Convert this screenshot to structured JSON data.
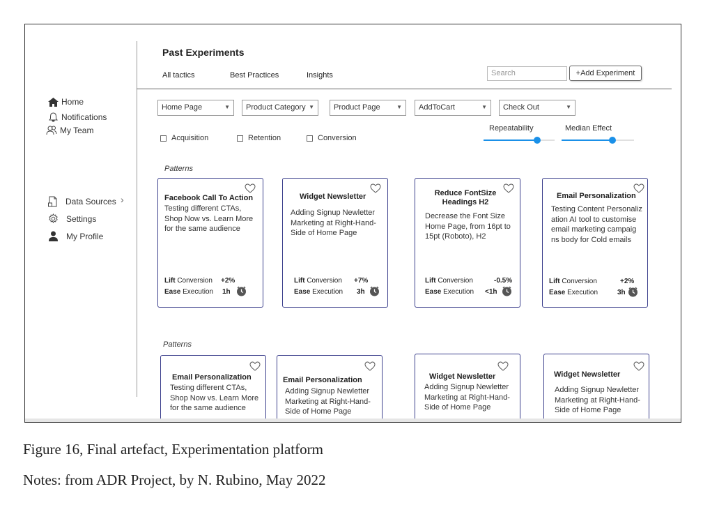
{
  "sidebar": {
    "top_items": [
      {
        "label": "Home",
        "icon": "home-icon"
      },
      {
        "label": "Notifications",
        "icon": "bell-icon"
      },
      {
        "label": "My Team",
        "icon": "team-icon"
      }
    ],
    "bottom_items": [
      {
        "label": "Data Sources",
        "icon": "data-sources-icon"
      },
      {
        "label": "Settings",
        "icon": "gear-icon"
      },
      {
        "label": "My Profile",
        "icon": "user-icon"
      }
    ]
  },
  "header": {
    "title": "Past Experiments",
    "tabs": [
      "All tactics",
      "Best Practices",
      "Insights"
    ],
    "search_placeholder": "Search",
    "add_button": "+Add Experiment"
  },
  "filters": {
    "dropdowns": [
      "Home Page",
      "Product Category",
      "Product Page",
      "AddToCart",
      "Check Out"
    ],
    "checkboxes": [
      "Acquisition",
      "Retention",
      "Conversion"
    ],
    "sliders": [
      {
        "label": "Repeatability",
        "value": 0.75
      },
      {
        "label": "Median Effect",
        "value": 0.7
      }
    ]
  },
  "sections": [
    {
      "label": "Patterns",
      "cards": [
        {
          "title": "Facebook Call To Action",
          "desc": "Testing different CTAs, Shop Now vs. Learn More for the same audience",
          "lift_label": "Lift",
          "lift_metric": "Conversion",
          "lift_value": "+2%",
          "ease_label": "Ease",
          "ease_metric": "Execution",
          "ease_value": "1h"
        },
        {
          "title": "Widget Newsletter",
          "desc": "Adding Signup Newletter Marketing at Right-Hand-Side of Home Page",
          "lift_label": "Lift",
          "lift_metric": "Conversion",
          "lift_value": "+7%",
          "ease_label": "Ease",
          "ease_metric": "Execution",
          "ease_value": "3h"
        },
        {
          "title": "Reduce FontSize Headings H2",
          "desc": "Decrease the Font Size Home Page, from 16pt to 15pt (Roboto), H2",
          "lift_label": "Lift",
          "lift_metric": "Conversion",
          "lift_value": "-0.5%",
          "ease_label": "Ease",
          "ease_metric": "Execution",
          "ease_value": "<1h"
        },
        {
          "title": "Email Personalization",
          "desc": "Testing Content Personaliz ation AI tool to customise email marketing campaig ns body for Cold emails",
          "lift_label": "Lift",
          "lift_metric": "Conversion",
          "lift_value": "+2%",
          "ease_label": "Ease",
          "ease_metric": "Execution",
          "ease_value": "3h"
        }
      ]
    },
    {
      "label": "Patterns",
      "cards": [
        {
          "title": "Email Personalization",
          "desc": "Testing different CTAs, Shop Now vs. Learn More for the same audience"
        },
        {
          "title": "Email Personalization",
          "desc": "Adding Signup Newletter Marketing at Right-Hand-Side of Home Page"
        },
        {
          "title": "Widget Newsletter",
          "desc": "Adding Signup Newletter Marketing at Right-Hand-Side of Home Page"
        },
        {
          "title": "Widget Newsletter",
          "desc": "Adding Signup Newletter Marketing at Right-Hand-Side of Home Page"
        }
      ]
    }
  ],
  "caption": {
    "line1": "Figure 16, Final artefact, Experimentation platform",
    "line2": "Notes: from ADR Project, by N. Rubino, May 2022"
  },
  "colors": {
    "accent": "#1a90e8",
    "card_border": "#3b3f8c",
    "clock": "#555555"
  }
}
